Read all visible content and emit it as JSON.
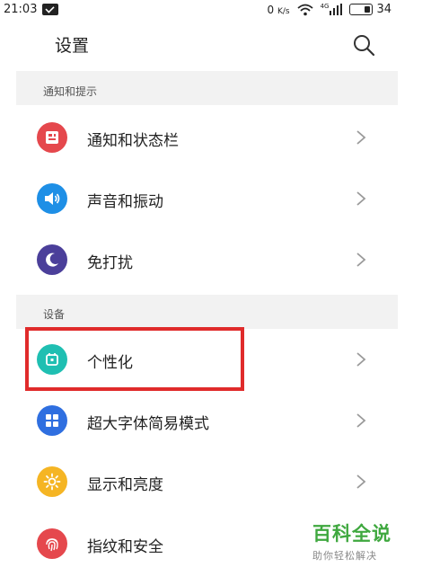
{
  "status": {
    "time": "21:03",
    "net_speed": "0",
    "net_speed_unit": "K/s",
    "network": "4G",
    "battery": "34",
    "battery_level": 0.34
  },
  "header": {
    "title": "设置",
    "search_icon": "search-icon"
  },
  "sections": [
    {
      "title": "通知和提示"
    },
    {
      "title": "设备"
    }
  ],
  "items": [
    {
      "label": "通知和状态栏",
      "icon": "notification-icon",
      "color": "#e5484d"
    },
    {
      "label": "声音和振动",
      "icon": "sound-icon",
      "color": "#1e8fe6"
    },
    {
      "label": "免打扰",
      "icon": "moon-icon",
      "color": "#4b3f9a"
    },
    {
      "label": "个性化",
      "icon": "personalize-icon",
      "color": "#1fbfb2"
    },
    {
      "label": "超大字体简易模式",
      "icon": "grid-icon",
      "color": "#2f6fe0"
    },
    {
      "label": "显示和亮度",
      "icon": "sun-icon",
      "color": "#f5b524"
    },
    {
      "label": "指纹和安全",
      "icon": "fingerprint-icon",
      "color": "#e5484d"
    }
  ],
  "highlight_color": "#e02b2b",
  "watermark": {
    "title": "百科全说",
    "subtitle": "助你轻松解决"
  }
}
